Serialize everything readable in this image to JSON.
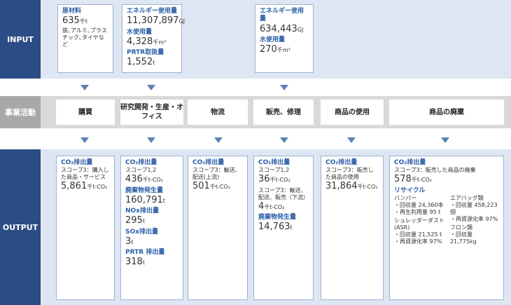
{
  "labels": {
    "input": "INPUT",
    "activity": "事業活動",
    "output": "OUTPUT"
  },
  "input": {
    "box1": {
      "title": "原材料",
      "value": "635",
      "unit": "千t",
      "note": "鉄､アルミ､プラスチック､タイヤなど"
    },
    "box2": {
      "t1": "エネルギー使用量",
      "v1": "11,307,897",
      "u1": "GJ",
      "t2": "水使用量",
      "v2": "4,328",
      "u2": "千m³",
      "t3": "PRTR取扱量",
      "v3": "1,552",
      "u3": "t"
    },
    "box3": {
      "t1": "エネルギー使用量",
      "v1": "634,443",
      "u1": "GJ",
      "t2": "水使用量",
      "v2": "270",
      "u2": "千m³"
    }
  },
  "activities": [
    "購買",
    "研究開発・生産・オフィス",
    "物流",
    "販売、修理",
    "商品の使用",
    "商品の廃棄"
  ],
  "output": {
    "o1": {
      "title": "CO₂排出量",
      "desc": "スコープ3：購入した商品・サービス",
      "value": "5,861",
      "unit": "千t-CO₂"
    },
    "o2": {
      "title": "CO₂排出量",
      "desc": "スコープ1,2",
      "value": "436",
      "unit": "千t-CO₂",
      "t2": "廃棄物発生量",
      "v2": "160,791",
      "u2": "t",
      "t3": "NOx排出量",
      "v3": "295",
      "u3": "t",
      "t4": "SOx排出量",
      "v4": "3",
      "u4": "t",
      "t5": "PRTR 排出量",
      "v5": "318",
      "u5": "t"
    },
    "o3": {
      "title": "CO₂排出量",
      "desc": "スコープ3：輸送、配送(上流)",
      "value": "501",
      "unit": "千t-CO₂"
    },
    "o4": {
      "title": "CO₂排出量",
      "desc": "スコープ1,2",
      "value": "36",
      "unit": "千t-CO₂",
      "desc2": "スコープ3：輸送、配送、販売（下流）",
      "value2": "4",
      "unit2": "千t-CO₂",
      "t3": "廃棄物発生量",
      "v3": "14,763",
      "u3": "t"
    },
    "o5": {
      "title": "CO₂排出量",
      "desc": "スコープ3：販売した商品の使用",
      "value": "31,864",
      "unit": "千t-CO₂"
    },
    "o6": {
      "title": "CO₂排出量",
      "desc": "スコープ3：販売した商品の廃棄",
      "value": "578",
      "unit": "千t-CO₂",
      "recycle": "リサイクル",
      "bumper": "バンパー",
      "b1": "・回収量 24,360本",
      "b2": "・再生利用量 95 t",
      "asr": "シュレッダーダスト(ASR)",
      "a1": "・回収量 21,525 t",
      "a2": "・再資源化率 97%",
      "airbag": "エアバッグ類",
      "ab1": "・回収量 458,223個",
      "ab2": "・再資源化率 97%",
      "freon": "フロン類",
      "f1": "・回収量 21,775kg"
    }
  }
}
